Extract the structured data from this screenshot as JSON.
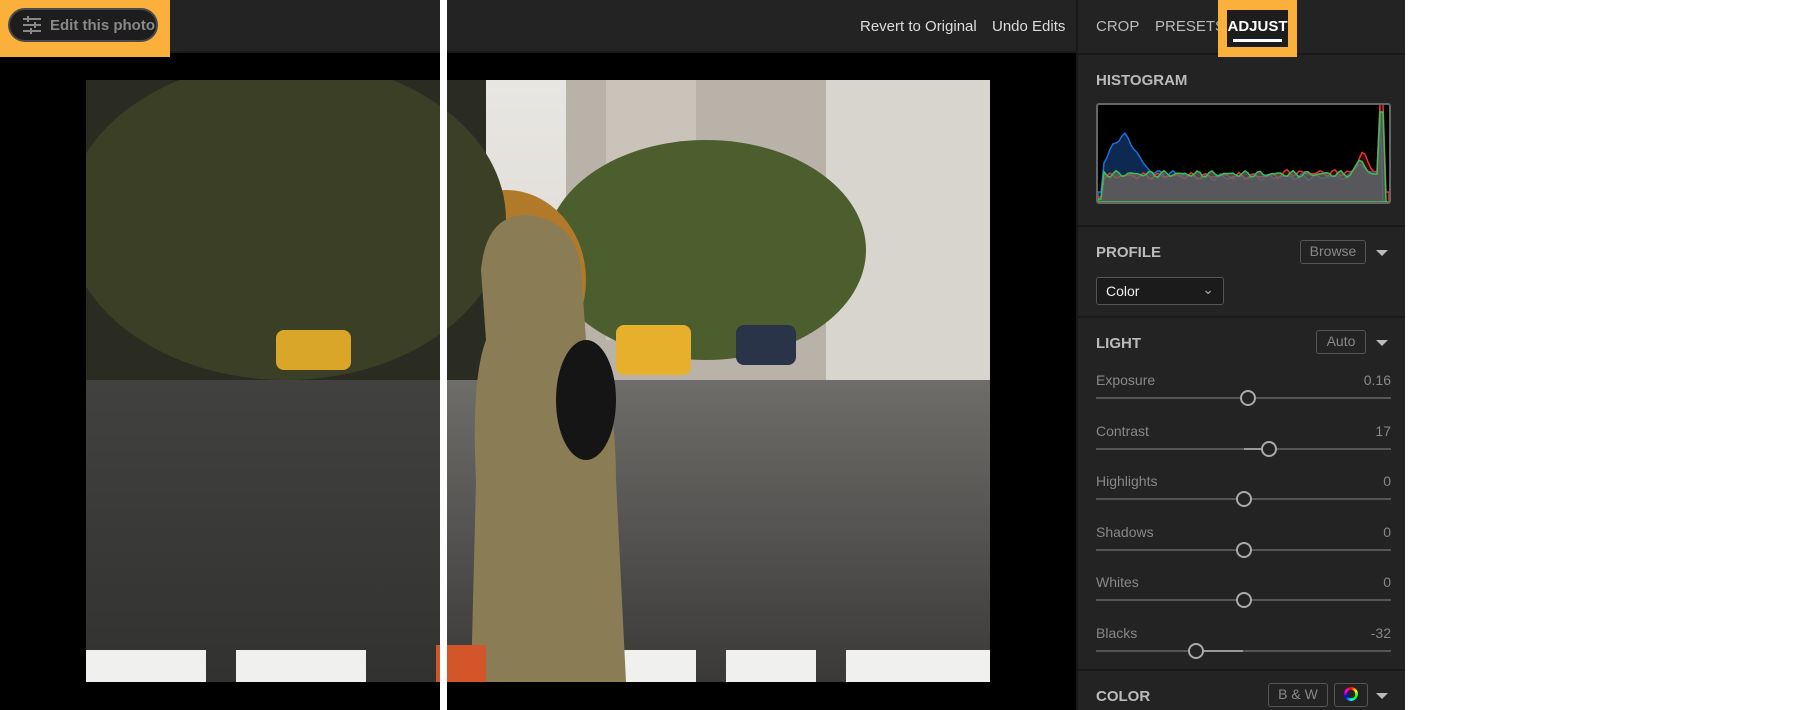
{
  "toolbar": {
    "edit_photo": "Edit this photo",
    "revert": "Revert to Original",
    "undo": "Undo Edits"
  },
  "tabs": {
    "crop": "CROP",
    "presets": "PRESETS",
    "adjust": "ADJUST"
  },
  "histogram": {
    "title": "HISTOGRAM"
  },
  "profile": {
    "title": "PROFILE",
    "browse": "Browse",
    "value": "Color"
  },
  "light": {
    "title": "LIGHT",
    "auto": "Auto",
    "sliders": [
      {
        "label": "Exposure",
        "value": "0.16",
        "num": 0.16,
        "min": -5,
        "max": 5
      },
      {
        "label": "Contrast",
        "value": "17",
        "num": 17,
        "min": -100,
        "max": 100
      },
      {
        "label": "Highlights",
        "value": "0",
        "num": 0,
        "min": -100,
        "max": 100
      },
      {
        "label": "Shadows",
        "value": "0",
        "num": 0,
        "min": -100,
        "max": 100
      },
      {
        "label": "Whites",
        "value": "0",
        "num": 0,
        "min": -100,
        "max": 100
      },
      {
        "label": "Blacks",
        "value": "-32",
        "num": -32,
        "min": -100,
        "max": 100
      }
    ]
  },
  "color": {
    "title": "COLOR",
    "bw": "B & W"
  },
  "colors": {
    "highlight": "#fbb03b",
    "panel": "#232323"
  }
}
